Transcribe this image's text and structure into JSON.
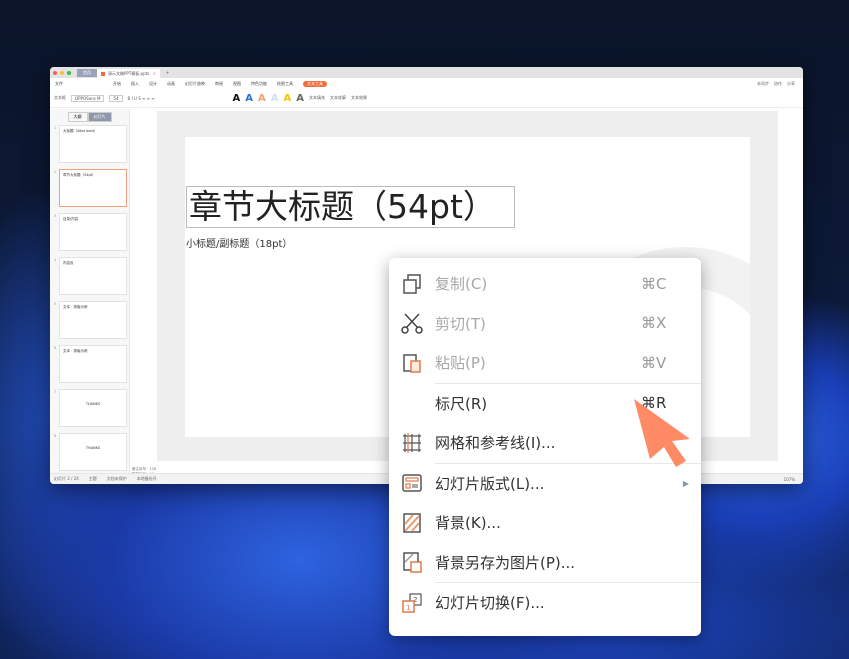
{
  "window": {
    "home_tab": "首页",
    "file_tab": "演示文稿PPT模板.pptx",
    "menu": [
      "文件",
      "开始",
      "插入",
      "设计",
      "动画",
      "幻灯片放映",
      "审阅",
      "视图",
      "特色功能",
      "绘图工具",
      "文本工具"
    ],
    "right_actions": [
      "未同步",
      "协作",
      "分享"
    ],
    "toolbar": {
      "font": "OPPOSans M",
      "size": "54",
      "textbox": "文本框",
      "fill": "文本填充",
      "outline": "文本轮廓",
      "effects": "文本效果"
    }
  },
  "side": {
    "tabs": [
      "大纲",
      "幻灯片"
    ],
    "thumbs": [
      {
        "n": "1",
        "text": "大标题（48pt bold）"
      },
      {
        "n": "2",
        "text": "章节大标题（54pt）"
      },
      {
        "n": "3",
        "text": "目录/内容"
      },
      {
        "n": "4",
        "text": "内容页"
      },
      {
        "n": "5",
        "text": "文本 · 排版示例"
      },
      {
        "n": "6",
        "text": "文本 · 排版示例"
      },
      {
        "n": "7",
        "text": "THANKS"
      },
      {
        "n": "8",
        "text": "THANKS"
      }
    ]
  },
  "slide": {
    "title": "章节大标题（54pt）",
    "subtitle": "小标题/副标题（18pt）"
  },
  "status": {
    "page": "幻灯片 2 / 24",
    "theme": "主题",
    "protect": "文档未保护",
    "backup": "本地备份开",
    "zoom": "107%"
  },
  "notes": [
    "备注序号：128",
    "智能序号：16"
  ],
  "context_menu": [
    {
      "label": "复制(C)",
      "shortcut": "⌘C",
      "icon": "copy-icon",
      "disabled": true
    },
    {
      "label": "剪切(T)",
      "shortcut": "⌘X",
      "icon": "scissors-icon",
      "disabled": true
    },
    {
      "label": "粘贴(P)",
      "shortcut": "⌘V",
      "icon": "paste-icon",
      "disabled": true
    },
    {
      "label": "标尺(R)",
      "shortcut": "⌘R"
    },
    {
      "label": "网格和参考线(I)..."
    },
    {
      "label": "幻灯片版式(L)..."
    },
    {
      "label": "背景(K)..."
    },
    {
      "label": "背景另存为图片(P)..."
    },
    {
      "label": "幻灯片切换(F)..."
    }
  ],
  "colors": {
    "accent": "#f26b3a",
    "cursor": "#ff8a66"
  }
}
